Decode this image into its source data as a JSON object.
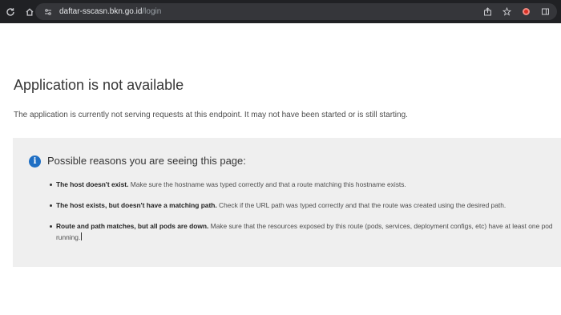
{
  "browser": {
    "url_host": "daftar-sscasn.bkn.go.id",
    "url_path": "/login"
  },
  "page": {
    "title": "Application is not available",
    "description": "The application is currently not serving requests at this endpoint. It may not have been started or is still starting.",
    "reasons_title": "Possible reasons you are seeing this page:",
    "reasons": [
      {
        "bold": "The host doesn't exist.",
        "text": " Make sure the hostname was typed correctly and that a route matching this hostname exists."
      },
      {
        "bold": "The host exists, but doesn't have a matching path.",
        "text": " Check if the URL path was typed correctly and that the route was created using the desired path."
      },
      {
        "bold": "Route and path matches, but all pods are down.",
        "text": " Make sure that the resources exposed by this route (pods, services, deployment configs, etc) have at least one pod running."
      }
    ]
  },
  "colors": {
    "toolbar": "#202124",
    "omnibox": "#35363a",
    "panel": "#efefef",
    "info_icon": "#1f6fc4"
  }
}
